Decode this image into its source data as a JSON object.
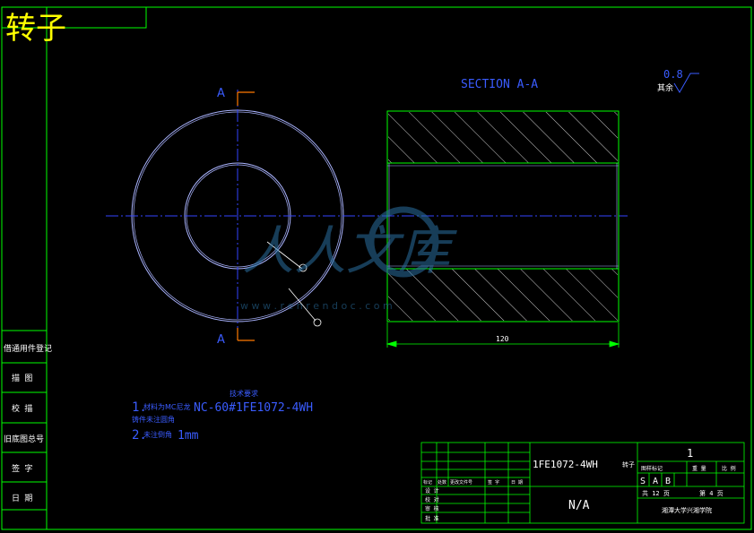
{
  "title": "转子",
  "section_label": "SECTION A-A",
  "cut_letters": {
    "top": "A",
    "bottom": "A"
  },
  "roughness": {
    "value": "0.8",
    "note": "其余"
  },
  "dimension_length": "120",
  "sidebar": [
    "借通用件登记",
    "描 图",
    "校 描",
    "旧底图总号",
    "签 字",
    "日 期"
  ],
  "notes": {
    "heading": "技术要求",
    "line1_prefix": "1.",
    "line1_small": "材料为MC尼龙",
    "line1_main": "NC-60#1FE1072-4WH",
    "line2_sub": "铸件未注圆角",
    "line2_prefix": "2.",
    "line2_small": "未注倒角",
    "line2_main": "1mm"
  },
  "title_block": {
    "drawing_number": "1FE1072-4WH",
    "part_name": "转子",
    "material_mark": "N/A",
    "count": "1",
    "stage_label": "图样标记",
    "weight_label": "重 量",
    "scale_label": "比 例",
    "stage_marks": [
      "S",
      "A",
      "B"
    ],
    "sheets": "共 12 页",
    "sheet": "第 4 页",
    "company": "湘潭大学兴湘学院",
    "rev_headers": [
      "标记",
      "处数",
      "更改文件号",
      "签 字",
      "日 期"
    ],
    "roles": [
      "设 计",
      "校 对",
      "审 核",
      "批 准"
    ]
  },
  "watermark": {
    "text": "人人文库",
    "url": "w w w . r e n r e n d o c . c o m"
  },
  "colors": {
    "frame": "#00ff00",
    "lines": "#ffffff",
    "circles": "#aab4ff",
    "center": "#3344ff",
    "blue_text": "#3a5cff",
    "cut": "#ff7a00",
    "title": "#ffff00"
  }
}
